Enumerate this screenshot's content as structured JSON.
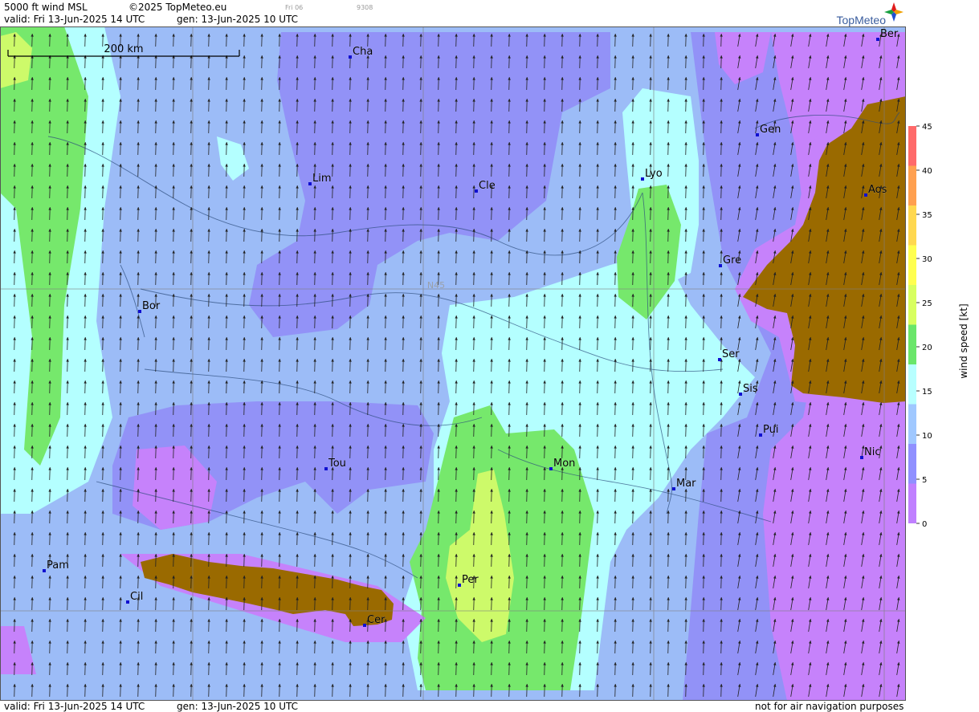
{
  "header": {
    "product": "5000 ft wind MSL",
    "copyright": "©2025 TopMeteo.eu",
    "day_code": "Fri 06",
    "run_code": "9308",
    "valid": "valid:  Fri  13-Jun-2025  14 UTC",
    "gen": "gen: 13-Jun-2025 10 UTC"
  },
  "footer": {
    "valid": "valid:  Fri  13-Jun-2025  14 UTC",
    "gen": "gen: 13-Jun-2025 10 UTC",
    "disclaimer": "not for air navigation purposes"
  },
  "brand": {
    "name": "TopMeteo",
    "logo_icon": "compass-star-icon"
  },
  "scale_bar": {
    "label": "200 km"
  },
  "grid": {
    "parallel_label": "N45"
  },
  "legend": {
    "title": "wind speed [kt]",
    "ticks": [
      "45",
      "40",
      "35",
      "30",
      "25",
      "20",
      "15",
      "10",
      "5",
      "0"
    ],
    "colors": [
      "#ff6a6a",
      "#ffa050",
      "#ffd850",
      "#ffff50",
      "#d8ff60",
      "#6ae66a",
      "#b8ffff",
      "#a0c8ff",
      "#9090ff",
      "#c080ff"
    ]
  },
  "palette": {
    "calm": "#c682fb",
    "light": "#9292f7",
    "moderate": "#9cbcf7",
    "fresh": "#b4ffff",
    "strong": "#76e86c",
    "stronger": "#cdfa6a",
    "terrain": "#9a6a00"
  },
  "cities": [
    {
      "name": "Cha"
    },
    {
      "name": "Ber"
    },
    {
      "name": "Gen"
    },
    {
      "name": "Lim"
    },
    {
      "name": "Cle"
    },
    {
      "name": "Lyo"
    },
    {
      "name": "Aos"
    },
    {
      "name": "Gre"
    },
    {
      "name": "Bor"
    },
    {
      "name": "Ser"
    },
    {
      "name": "Sis"
    },
    {
      "name": "Pui"
    },
    {
      "name": "Nic"
    },
    {
      "name": "Tou"
    },
    {
      "name": "Mon"
    },
    {
      "name": "Mar"
    },
    {
      "name": "Pam"
    },
    {
      "name": "Cil"
    },
    {
      "name": "Per"
    },
    {
      "name": "Cer"
    }
  ]
}
